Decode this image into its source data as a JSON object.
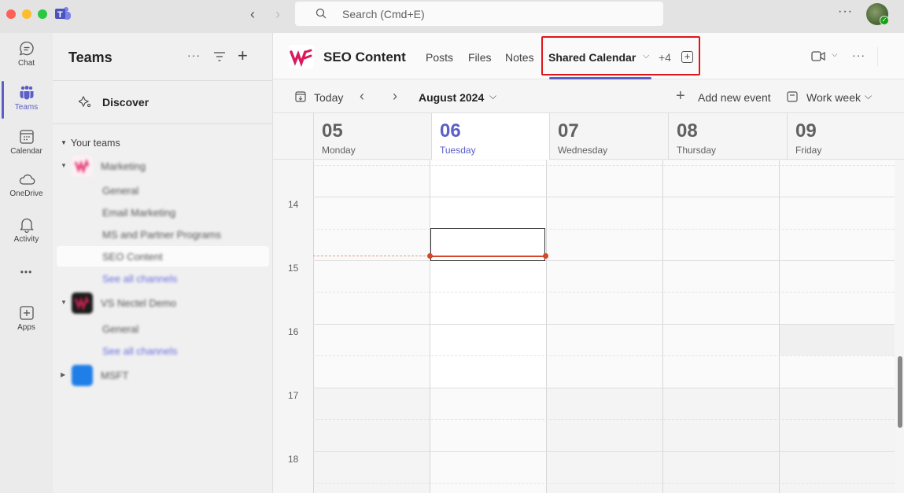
{
  "window": {
    "search_placeholder": "Search (Cmd+E)",
    "back_icon": "chevron-left-icon",
    "forward_icon": "chevron-right-icon"
  },
  "rail": {
    "items": [
      {
        "label": "Chat",
        "icon": "chat-icon",
        "active": false
      },
      {
        "label": "Teams",
        "icon": "teams-icon",
        "active": true
      },
      {
        "label": "Calendar",
        "icon": "calendar-icon",
        "active": false
      },
      {
        "label": "OneDrive",
        "icon": "cloud-icon",
        "active": false
      },
      {
        "label": "Activity",
        "icon": "bell-icon",
        "active": false
      },
      {
        "label": "Apps",
        "icon": "apps-icon",
        "active": false
      }
    ],
    "more_label": "•••"
  },
  "teams_panel": {
    "title": "Teams",
    "more_label": "···",
    "add_label": "+",
    "discover_label": "Discover",
    "section_label": "Your teams",
    "teams": [
      {
        "name": "Marketing",
        "expanded": true,
        "avatar_color": "#e6437a",
        "channels": [
          "General",
          "Email Marketing",
          "MS and Partner Programs",
          "SEO Content"
        ],
        "active_channel": "SEO Content",
        "see_all": "See all channels"
      },
      {
        "name": "VS Nectel Demo",
        "expanded": true,
        "avatar_color": "#1b1b1b",
        "channels": [
          "General"
        ],
        "see_all": "See all channels"
      },
      {
        "name": "MSFT",
        "expanded": false,
        "avatar_color": "#1f7ee8",
        "channels": []
      }
    ]
  },
  "channel_header": {
    "title": "SEO Content",
    "tabs": [
      {
        "label": "Posts",
        "active": false
      },
      {
        "label": "Files",
        "active": false
      },
      {
        "label": "Notes",
        "active": false
      },
      {
        "label": "Shared Calendar",
        "active": true
      }
    ],
    "more_tabs": "+4",
    "add_tab": "+",
    "more_label": "···",
    "brand_color": "#5b5fc7",
    "highlight_color": "#e0141a"
  },
  "calendar_toolbar": {
    "today_label": "Today",
    "month_label": "August 2024",
    "add_event_label": "Add new event",
    "view_label": "Work week"
  },
  "calendar": {
    "days": [
      {
        "num": "05",
        "name": "Monday",
        "today": false
      },
      {
        "num": "06",
        "name": "Tuesday",
        "today": true
      },
      {
        "num": "07",
        "name": "Wednesday",
        "today": false
      },
      {
        "num": "08",
        "name": "Thursday",
        "today": false
      },
      {
        "num": "09",
        "name": "Friday",
        "today": false
      }
    ],
    "hours": [
      "14",
      "15",
      "16",
      "17",
      "18"
    ],
    "current_time_color": "#d4472b"
  }
}
